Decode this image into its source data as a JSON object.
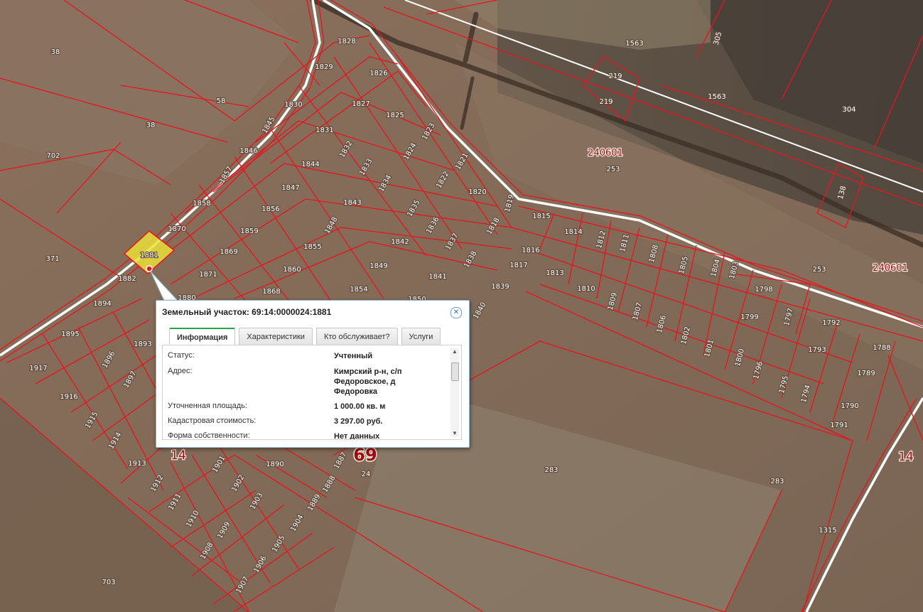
{
  "map": {
    "parcel_labels": [
      "38",
      "58",
      "38",
      "702",
      "371",
      "1828",
      "1829",
      "1826",
      "1827",
      "1825",
      "1830",
      "1831",
      "1845",
      "1846",
      "1832",
      "1833",
      "1823",
      "1824",
      "1821",
      "1844",
      "1834",
      "1822",
      "1820",
      "1857",
      "1847",
      "1843",
      "1835",
      "1819",
      "1815",
      "1858",
      "1856",
      "1836",
      "1818",
      "1814",
      "1812",
      "1811",
      "1870",
      "1859",
      "1848",
      "1842",
      "1837",
      "1816",
      "1808",
      "1805",
      "1804",
      "1803",
      "1881",
      "1869",
      "1855",
      "1838",
      "1817",
      "1813",
      "1882",
      "1871",
      "1860",
      "1849",
      "1841",
      "1839",
      "1810",
      "1809",
      "1807",
      "1806",
      "1802",
      "1801",
      "1800",
      "1880",
      "1868",
      "1854",
      "1850",
      "1840",
      "1798",
      "1799",
      "1797",
      "1792",
      "1793",
      "1788",
      "1894",
      "1895",
      "1893",
      "1896",
      "1897",
      "1917",
      "1916",
      "1915",
      "1914",
      "1913",
      "1912",
      "1911",
      "1910",
      "1909",
      "1908",
      "1907",
      "1906",
      "1905",
      "1904",
      "1889",
      "1888",
      "1887",
      "1890",
      "1902",
      "1903",
      "1901",
      "1796",
      "1795",
      "1794",
      "1790",
      "1791",
      "1789",
      "1563",
      "1563",
      "305",
      "219",
      "219",
      "304",
      "253",
      "253",
      "138",
      "283",
      "283",
      "1315",
      "703",
      "24"
    ],
    "quarter_labels": [
      "240601",
      "240601"
    ],
    "region_labels": [
      "14",
      "69",
      "14"
    ],
    "highlight_color": "#e8e03a",
    "parcel_color": "#e8141c"
  },
  "popup": {
    "title": "Земельный участок: 69:14:0000024:1881",
    "close_icon": "close-icon",
    "tabs": [
      {
        "label": "Информация",
        "active": true
      },
      {
        "label": "Характеристики",
        "active": false
      },
      {
        "label": "Кто обслуживает?",
        "active": false
      },
      {
        "label": "Услуги",
        "active": false
      }
    ],
    "rows": [
      {
        "key": "Статус:",
        "value": "Учтенный"
      },
      {
        "key": "Адрес:",
        "value": "Кимрский р-н, с/п Федоровское, д Федоровка"
      },
      {
        "key": "Уточненная площадь:",
        "value": "1 000.00 кв. м"
      },
      {
        "key": "Кадастровая стоимость:",
        "value": "3 297.00 руб."
      },
      {
        "key": "Форма собственности:",
        "value": "Нет данных"
      }
    ]
  }
}
